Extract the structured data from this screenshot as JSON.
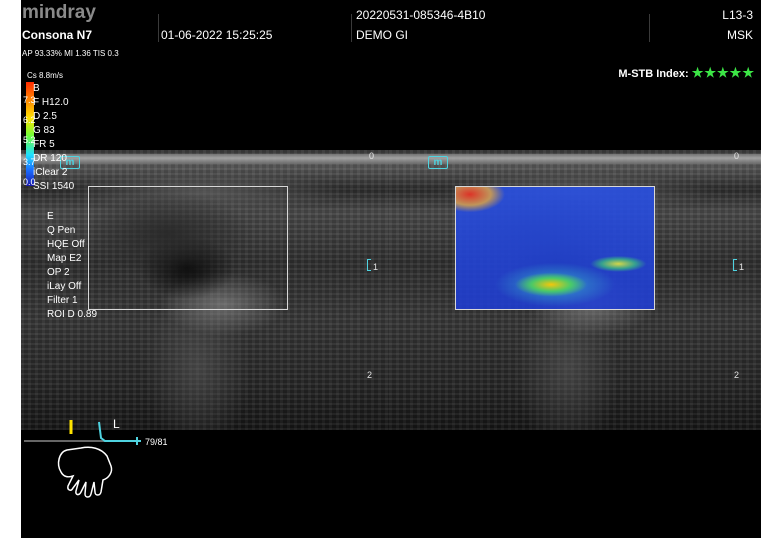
{
  "header": {
    "logo": "mindray",
    "model": "Consona N7",
    "datetime": "01-06-2022 15:25:25",
    "exam_id": "20220531-085346-4B10",
    "department": "DEMO GI",
    "probe": "L13-3",
    "preset": "MSK"
  },
  "safety": "AP 93.33%  MI 1.36  TIS 0.3",
  "stb_index": {
    "label": "M-STB Index:",
    "stars": "★★★★★"
  },
  "scale": {
    "label": "Cs 8.8m/s",
    "ticks": [
      "7.3",
      "6.2",
      "5.2",
      "3.7",
      "0.0"
    ]
  },
  "b_params": [
    "B",
    "F H12.0",
    "D 2.5",
    "G 83",
    "FR 5",
    "DR 120",
    "iClear 2",
    "SSI 1540"
  ],
  "e_params": [
    "E",
    "Q Pen",
    "HQE Off",
    "Map E2",
    "OP 2",
    "iLay Off",
    "Filter 1",
    "ROI D 0.89"
  ],
  "depth_left": [
    "0",
    "1",
    "2"
  ],
  "depth_right": [
    "0",
    "1",
    "2"
  ],
  "icons": {
    "mode_icon": "m",
    "focus_icon": "focus-marker-icon"
  },
  "bodymark": {
    "side": "L",
    "frame_counter": "79/81"
  },
  "colors": {
    "accent": "#4fd3e0",
    "stars": "#3ce646",
    "roi_box": "#d8d8d8"
  }
}
